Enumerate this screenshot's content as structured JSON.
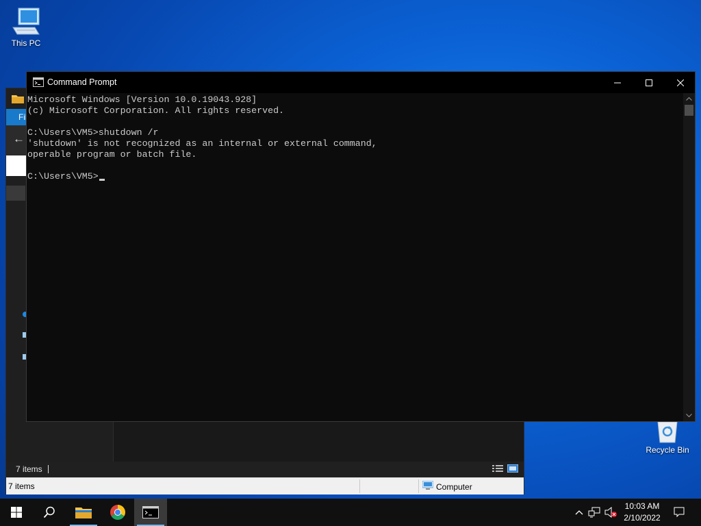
{
  "desktop": {
    "icons": [
      {
        "label": "This PC",
        "icon": "this-pc-icon"
      },
      {
        "label": "Recycle Bin",
        "icon": "recycle-bin-icon"
      }
    ]
  },
  "explorer": {
    "ribbon_label": "File",
    "status_top_count": "7 items",
    "status_bottom_count": "7 items",
    "status_location": "Computer"
  },
  "cmd": {
    "title": "Command Prompt",
    "lines": [
      "Microsoft Windows [Version 10.0.19043.928]",
      "(c) Microsoft Corporation. All rights reserved.",
      "",
      "C:\\Users\\VM5>shutdown /r",
      "'shutdown' is not recognized as an internal or external command,",
      "operable program or batch file.",
      "",
      "C:\\Users\\VM5>"
    ],
    "colors": {
      "background": "#0c0c0c",
      "text": "#cccccc"
    }
  },
  "taskbar": {
    "apps": [
      {
        "name": "Start",
        "icon": "windows-icon"
      },
      {
        "name": "Search",
        "icon": "search-icon"
      },
      {
        "name": "File Explorer",
        "icon": "folder-icon"
      },
      {
        "name": "Google Chrome",
        "icon": "chrome-icon"
      },
      {
        "name": "Command Prompt",
        "icon": "cmd-icon",
        "active": true
      }
    ],
    "clock_time": "10:03 AM",
    "clock_date": "2/10/2022"
  }
}
